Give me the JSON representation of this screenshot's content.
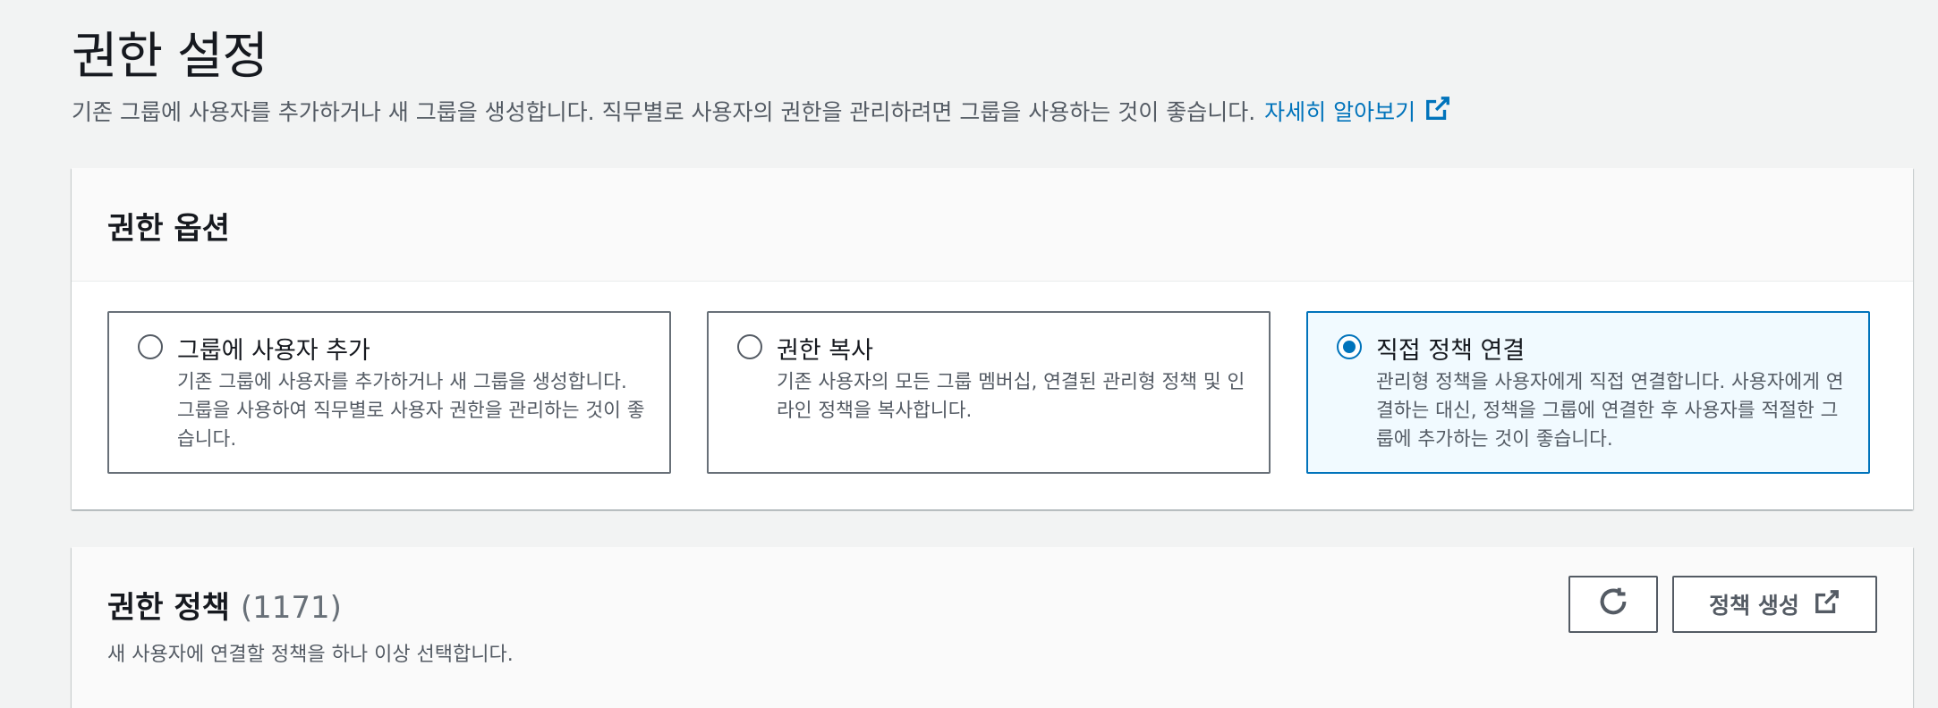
{
  "header": {
    "title": "권한 설정",
    "description": "기존 그룹에 사용자를 추가하거나 새 그룹을 생성합니다. 직무별로 사용자의 권한을 관리하려면 그룹을 사용하는 것이 좋습니다.",
    "learn_more": "자세히 알아보기"
  },
  "options_panel": {
    "title": "권한 옵션",
    "tiles": [
      {
        "label": "그룹에 사용자 추가",
        "description": "기존 그룹에 사용자를 추가하거나 새 그룹을 생성합니다. 그룹을 사용하여 직무별로 사용자 권한을 관리하는 것이 좋습니다.",
        "selected": false
      },
      {
        "label": "권한 복사",
        "description": "기존 사용자의 모든 그룹 멤버십, 연결된 관리형 정책 및 인라인 정책을 복사합니다.",
        "selected": false
      },
      {
        "label": "직접 정책 연결",
        "description": "관리형 정책을 사용자에게 직접 연결합니다. 사용자에게 연결하는 대신, 정책을 그룹에 연결한 후 사용자를 적절한 그룹에 추가하는 것이 좋습니다.",
        "selected": true
      }
    ]
  },
  "policies_panel": {
    "title": "권한 정책",
    "count": "(1171)",
    "description": "새 사용자에 연결할 정책을 하나 이상 선택합니다.",
    "create_button": "정책 생성",
    "refresh_icon": "refresh-icon"
  },
  "colors": {
    "accent": "#0073bb",
    "selected_bg": "#f1faff",
    "page_bg": "#f2f3f3"
  }
}
